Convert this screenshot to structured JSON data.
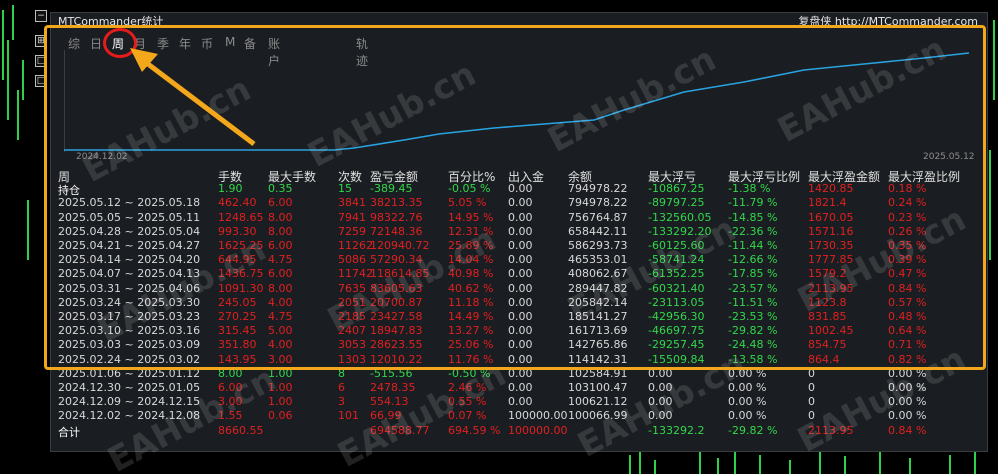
{
  "window": {
    "title": "MTCommander统计",
    "copyright": "复盘侠 http://MTCommander.com"
  },
  "left_buttons": [
    "−",
    "⊞",
    "□",
    "□"
  ],
  "tabs": [
    {
      "label": "综",
      "active": false
    },
    {
      "label": "日",
      "active": false
    },
    {
      "label": "周",
      "active": true
    },
    {
      "label": "月",
      "active": false
    },
    {
      "label": "季",
      "active": false
    },
    {
      "label": "年",
      "active": false
    },
    {
      "label": "币",
      "active": false
    },
    {
      "label": "M",
      "active": false
    },
    {
      "label": "备",
      "active": false
    },
    {
      "label": "账户",
      "active": false
    },
    {
      "label": "轨迹",
      "active": false
    }
  ],
  "equity_chart": {
    "start_date": "2024.12.02",
    "end_date": "2025.05.12",
    "line_color": "#29a3e0"
  },
  "table": {
    "headers": [
      "周",
      "手数",
      "最大手数",
      "次数",
      "盈亏金额",
      "百分比%",
      "出入金",
      "余额",
      "最大浮亏",
      "最大浮亏比例",
      "最大浮盈金额",
      "最大浮盈比例"
    ],
    "holding": {
      "label": "持仓",
      "lots": "1.90",
      "max_lots": "0.35",
      "count": "15",
      "pnl": "-389.45",
      "pct": "-0.05 %",
      "flow": "0.00",
      "balance": "794978.22",
      "max_loss": "-10867.25",
      "max_loss_pct": "-1.38 %",
      "max_profit": "1420.85",
      "max_profit_pct": "0.18 %"
    },
    "rows": [
      {
        "period": "2025.05.12 ~ 2025.05.18",
        "lots": "462.40",
        "max_lots": "6.00",
        "count": "3841",
        "pnl": "38213.35",
        "pct": "5.05 %",
        "flow": "0.00",
        "balance": "794978.22",
        "max_loss": "-89797.25",
        "max_loss_pct": "-11.79 %",
        "max_profit": "1821.4",
        "max_profit_pct": "0.24 %",
        "color": "r"
      },
      {
        "period": "2025.05.05 ~ 2025.05.11",
        "lots": "1248.65",
        "max_lots": "8.00",
        "count": "7941",
        "pnl": "98322.76",
        "pct": "14.95 %",
        "flow": "0.00",
        "balance": "756764.87",
        "max_loss": "-132560.05",
        "max_loss_pct": "-14.85 %",
        "max_profit": "1670.05",
        "max_profit_pct": "0.23 %",
        "color": "r"
      },
      {
        "period": "2025.04.28 ~ 2025.05.04",
        "lots": "993.30",
        "max_lots": "8.00",
        "count": "7259",
        "pnl": "72148.36",
        "pct": "12.31 %",
        "flow": "0.00",
        "balance": "658442.11",
        "max_loss": "-133292.20",
        "max_loss_pct": "-22.36 %",
        "max_profit": "1571.16",
        "max_profit_pct": "0.26 %",
        "color": "r"
      },
      {
        "period": "2025.04.21 ~ 2025.04.27",
        "lots": "1625.25",
        "max_lots": "6.00",
        "count": "11262",
        "pnl": "120940.72",
        "pct": "25.89 %",
        "flow": "0.00",
        "balance": "586293.73",
        "max_loss": "-60125.60",
        "max_loss_pct": "-11.44 %",
        "max_profit": "1730.35",
        "max_profit_pct": "0.35 %",
        "color": "r"
      },
      {
        "period": "2025.04.14 ~ 2025.04.20",
        "lots": "644.95",
        "max_lots": "4.75",
        "count": "5086",
        "pnl": "57290.34",
        "pct": "14.04 %",
        "flow": "0.00",
        "balance": "465353.01",
        "max_loss": "-58741.24",
        "max_loss_pct": "-12.66 %",
        "max_profit": "1777.85",
        "max_profit_pct": "0.39 %",
        "color": "r"
      },
      {
        "period": "2025.04.07 ~ 2025.04.13",
        "lots": "1436.75",
        "max_lots": "6.00",
        "count": "11742",
        "pnl": "118614.85",
        "pct": "40.98 %",
        "flow": "0.00",
        "balance": "408062.67",
        "max_loss": "-61352.25",
        "max_loss_pct": "-17.85 %",
        "max_profit": "1579.2",
        "max_profit_pct": "0.47 %",
        "color": "r"
      },
      {
        "period": "2025.03.31 ~ 2025.04.06",
        "lots": "1091.30",
        "max_lots": "8.00",
        "count": "7635",
        "pnl": "83605.63",
        "pct": "40.62 %",
        "flow": "0.00",
        "balance": "289447.82",
        "max_loss": "-60321.40",
        "max_loss_pct": "-23.57 %",
        "max_profit": "2113.95",
        "max_profit_pct": "0.84 %",
        "color": "r"
      },
      {
        "period": "2025.03.24 ~ 2025.03.30",
        "lots": "245.05",
        "max_lots": "4.00",
        "count": "2051",
        "pnl": "20700.87",
        "pct": "11.18 %",
        "flow": "0.00",
        "balance": "205842.14",
        "max_loss": "-23113.05",
        "max_loss_pct": "-11.51 %",
        "max_profit": "1123.8",
        "max_profit_pct": "0.57 %",
        "color": "r"
      },
      {
        "period": "2025.03.17 ~ 2025.03.23",
        "lots": "270.25",
        "max_lots": "4.75",
        "count": "2185",
        "pnl": "23427.58",
        "pct": "14.49 %",
        "flow": "0.00",
        "balance": "185141.27",
        "max_loss": "-42956.30",
        "max_loss_pct": "-23.53 %",
        "max_profit": "831.85",
        "max_profit_pct": "0.48 %",
        "color": "r"
      },
      {
        "period": "2025.03.10 ~ 2025.03.16",
        "lots": "315.45",
        "max_lots": "5.00",
        "count": "2407",
        "pnl": "18947.83",
        "pct": "13.27 %",
        "flow": "0.00",
        "balance": "161713.69",
        "max_loss": "-46697.75",
        "max_loss_pct": "-29.82 %",
        "max_profit": "1002.45",
        "max_profit_pct": "0.64 %",
        "color": "r"
      },
      {
        "period": "2025.03.03 ~ 2025.03.09",
        "lots": "351.80",
        "max_lots": "4.00",
        "count": "3053",
        "pnl": "28623.55",
        "pct": "25.06 %",
        "flow": "0.00",
        "balance": "142765.86",
        "max_loss": "-29257.45",
        "max_loss_pct": "-24.48 %",
        "max_profit": "854.75",
        "max_profit_pct": "0.71 %",
        "color": "r"
      },
      {
        "period": "2025.02.24 ~ 2025.03.02",
        "lots": "143.95",
        "max_lots": "3.00",
        "count": "1303",
        "pnl": "12010.22",
        "pct": "11.76 %",
        "flow": "0.00",
        "balance": "114142.31",
        "max_loss": "-15509.84",
        "max_loss_pct": "-13.58 %",
        "max_profit": "864.4",
        "max_profit_pct": "0.82 %",
        "color": "r"
      },
      {
        "period": "2025.01.06 ~ 2025.01.12",
        "lots": "8.00",
        "max_lots": "1.00",
        "count": "8",
        "pnl": "-515.56",
        "pct": "-0.50 %",
        "flow": "0.00",
        "balance": "102584.91",
        "max_loss": "0.00",
        "max_loss_pct": "0.00 %",
        "max_profit": "0",
        "max_profit_pct": "0.00 %",
        "color": "g"
      },
      {
        "period": "2024.12.30 ~ 2025.01.05",
        "lots": "6.00",
        "max_lots": "1.00",
        "count": "6",
        "pnl": "2478.35",
        "pct": "2.46 %",
        "flow": "0.00",
        "balance": "103100.47",
        "max_loss": "0.00",
        "max_loss_pct": "0.00 %",
        "max_profit": "0",
        "max_profit_pct": "0.00 %",
        "color": "r"
      },
      {
        "period": "2024.12.09 ~ 2024.12.15",
        "lots": "3.00",
        "max_lots": "1.00",
        "count": "3",
        "pnl": "554.13",
        "pct": "0.55 %",
        "flow": "0.00",
        "balance": "100621.12",
        "max_loss": "0.00",
        "max_loss_pct": "0.00 %",
        "max_profit": "0",
        "max_profit_pct": "0.00 %",
        "color": "r"
      },
      {
        "period": "2024.12.02 ~ 2024.12.08",
        "lots": "1.55",
        "max_lots": "0.06",
        "count": "101",
        "pnl": "66.99",
        "pct": "0.07 %",
        "flow": "100000.00",
        "balance": "100066.99",
        "max_loss": "0.00",
        "max_loss_pct": "0.00 %",
        "max_profit": "0",
        "max_profit_pct": "0.00 %",
        "color": "r"
      }
    ],
    "total": {
      "label": "合计",
      "lots": "8660.55",
      "pnl": "694588.77",
      "pct": "694.59 %",
      "flow": "100000.00",
      "max_loss": "-133292.2",
      "max_loss_pct": "-29.82 %",
      "max_profit": "2113.95",
      "max_profit_pct": "0.84 %"
    }
  },
  "watermark": "EAHub.cn"
}
